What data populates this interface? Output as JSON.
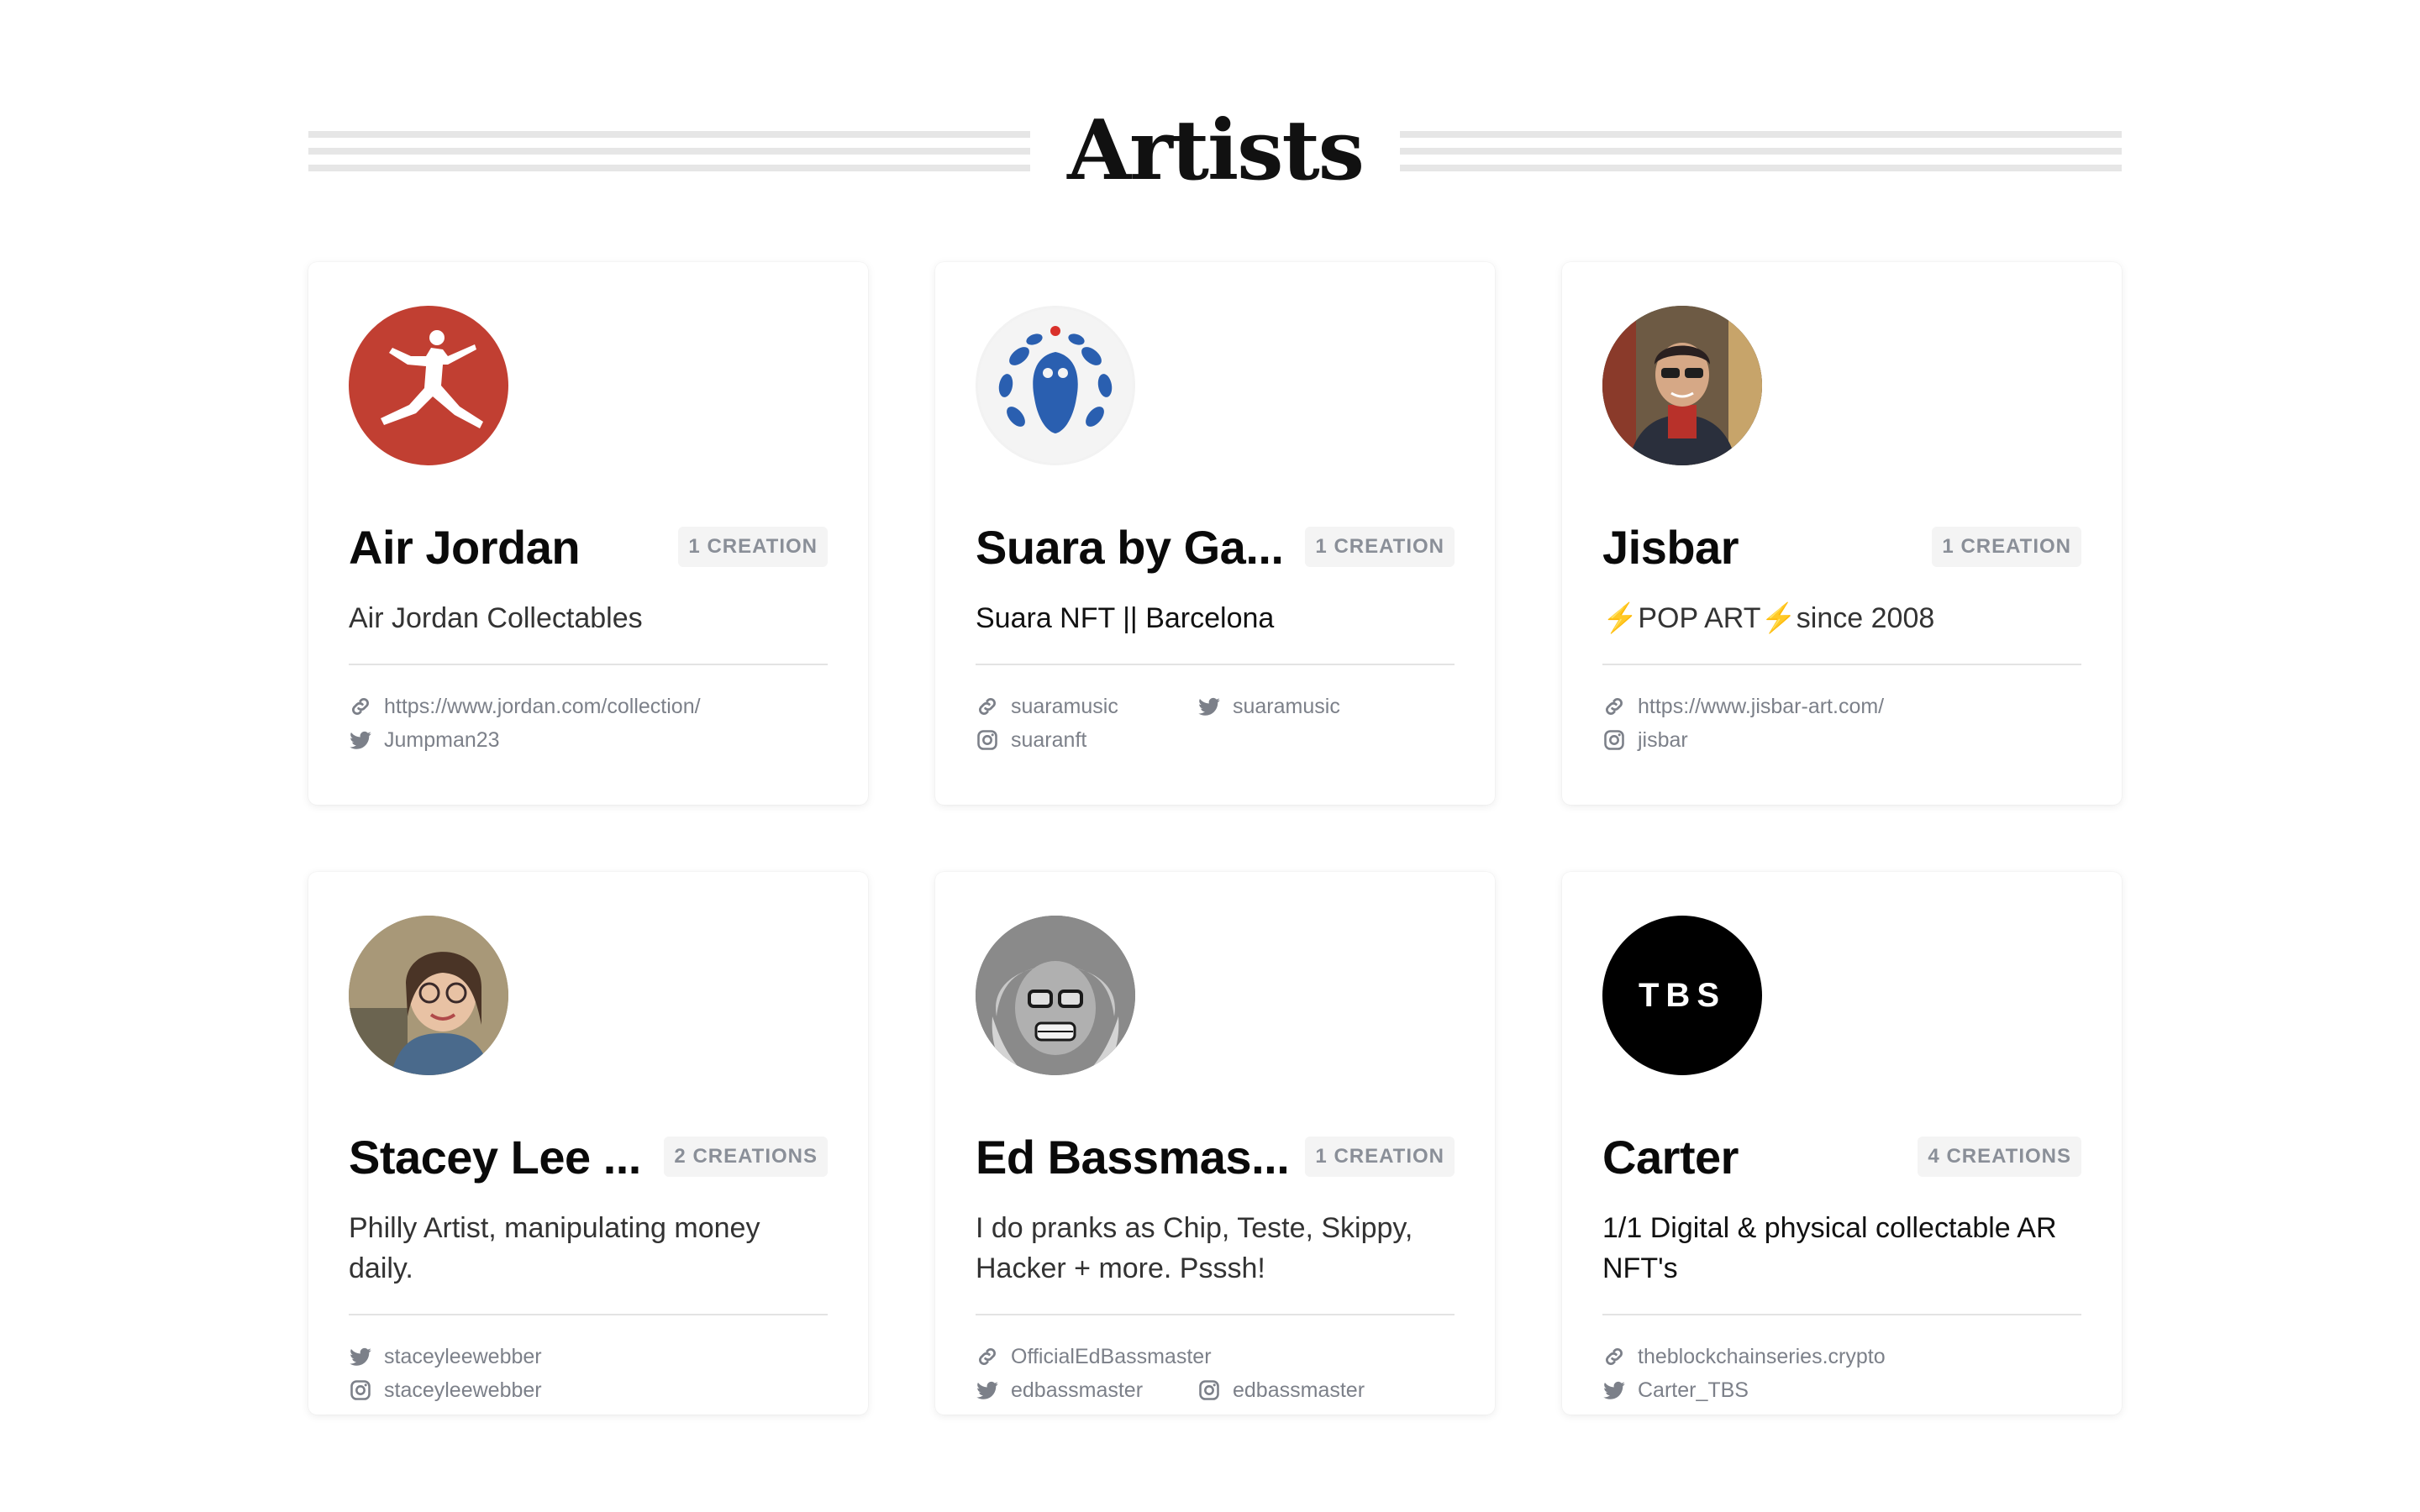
{
  "page": {
    "title": "Artists"
  },
  "artists": [
    {
      "name": "Air Jordan",
      "badge": "1 CREATION",
      "bio": "Air Jordan Collectables",
      "links": [
        {
          "type": "link-icon",
          "text": "https://www.jordan.com/collection/"
        },
        {
          "type": "twitter-icon",
          "text": "Jumpman23"
        }
      ]
    },
    {
      "name": "Suara by Ga...",
      "badge": "1 CREATION",
      "bio": "Suara NFT || Barcelona",
      "links": [
        {
          "type": "link-icon",
          "text": "suaramusic"
        },
        {
          "type": "twitter-icon",
          "text": "suaramusic"
        },
        {
          "type": "instagram-icon",
          "text": "suaranft"
        }
      ]
    },
    {
      "name": "Jisbar",
      "badge": "1 CREATION",
      "bio": "⚡POP ART⚡since 2008",
      "links": [
        {
          "type": "link-icon",
          "text": "https://www.jisbar-art.com/"
        },
        {
          "type": "instagram-icon",
          "text": "jisbar"
        }
      ]
    },
    {
      "name": "Stacey Lee ...",
      "badge": "2 CREATIONS",
      "bio": "Philly Artist, manipulating money daily.",
      "links": [
        {
          "type": "twitter-icon",
          "text": "staceyleewebber"
        },
        {
          "type": "instagram-icon",
          "text": "staceyleewebber"
        }
      ]
    },
    {
      "name": "Ed Bassmas...",
      "badge": "1 CREATION",
      "bio": "I do pranks as Chip, Teste, Skippy, Hacker + more. Psssh!",
      "links": [
        {
          "type": "link-icon",
          "text": "OfficialEdBassmaster"
        },
        {
          "type": "twitter-icon",
          "text": "edbassmaster"
        },
        {
          "type": "instagram-icon",
          "text": "edbassmaster"
        }
      ]
    },
    {
      "name": "Carter",
      "badge": "4 CREATIONS",
      "bio": "1/1 Digital & physical collectable AR NFT's",
      "avatar_text": "TBS",
      "links": [
        {
          "type": "link-icon",
          "text": "theblockchainseries.crypto"
        },
        {
          "type": "twitter-icon",
          "text": "Carter_TBS"
        }
      ]
    }
  ],
  "colors": {
    "jordan_red": "#c13f32",
    "suara_blue": "#2a5fb0",
    "text_muted": "#7c8089"
  }
}
